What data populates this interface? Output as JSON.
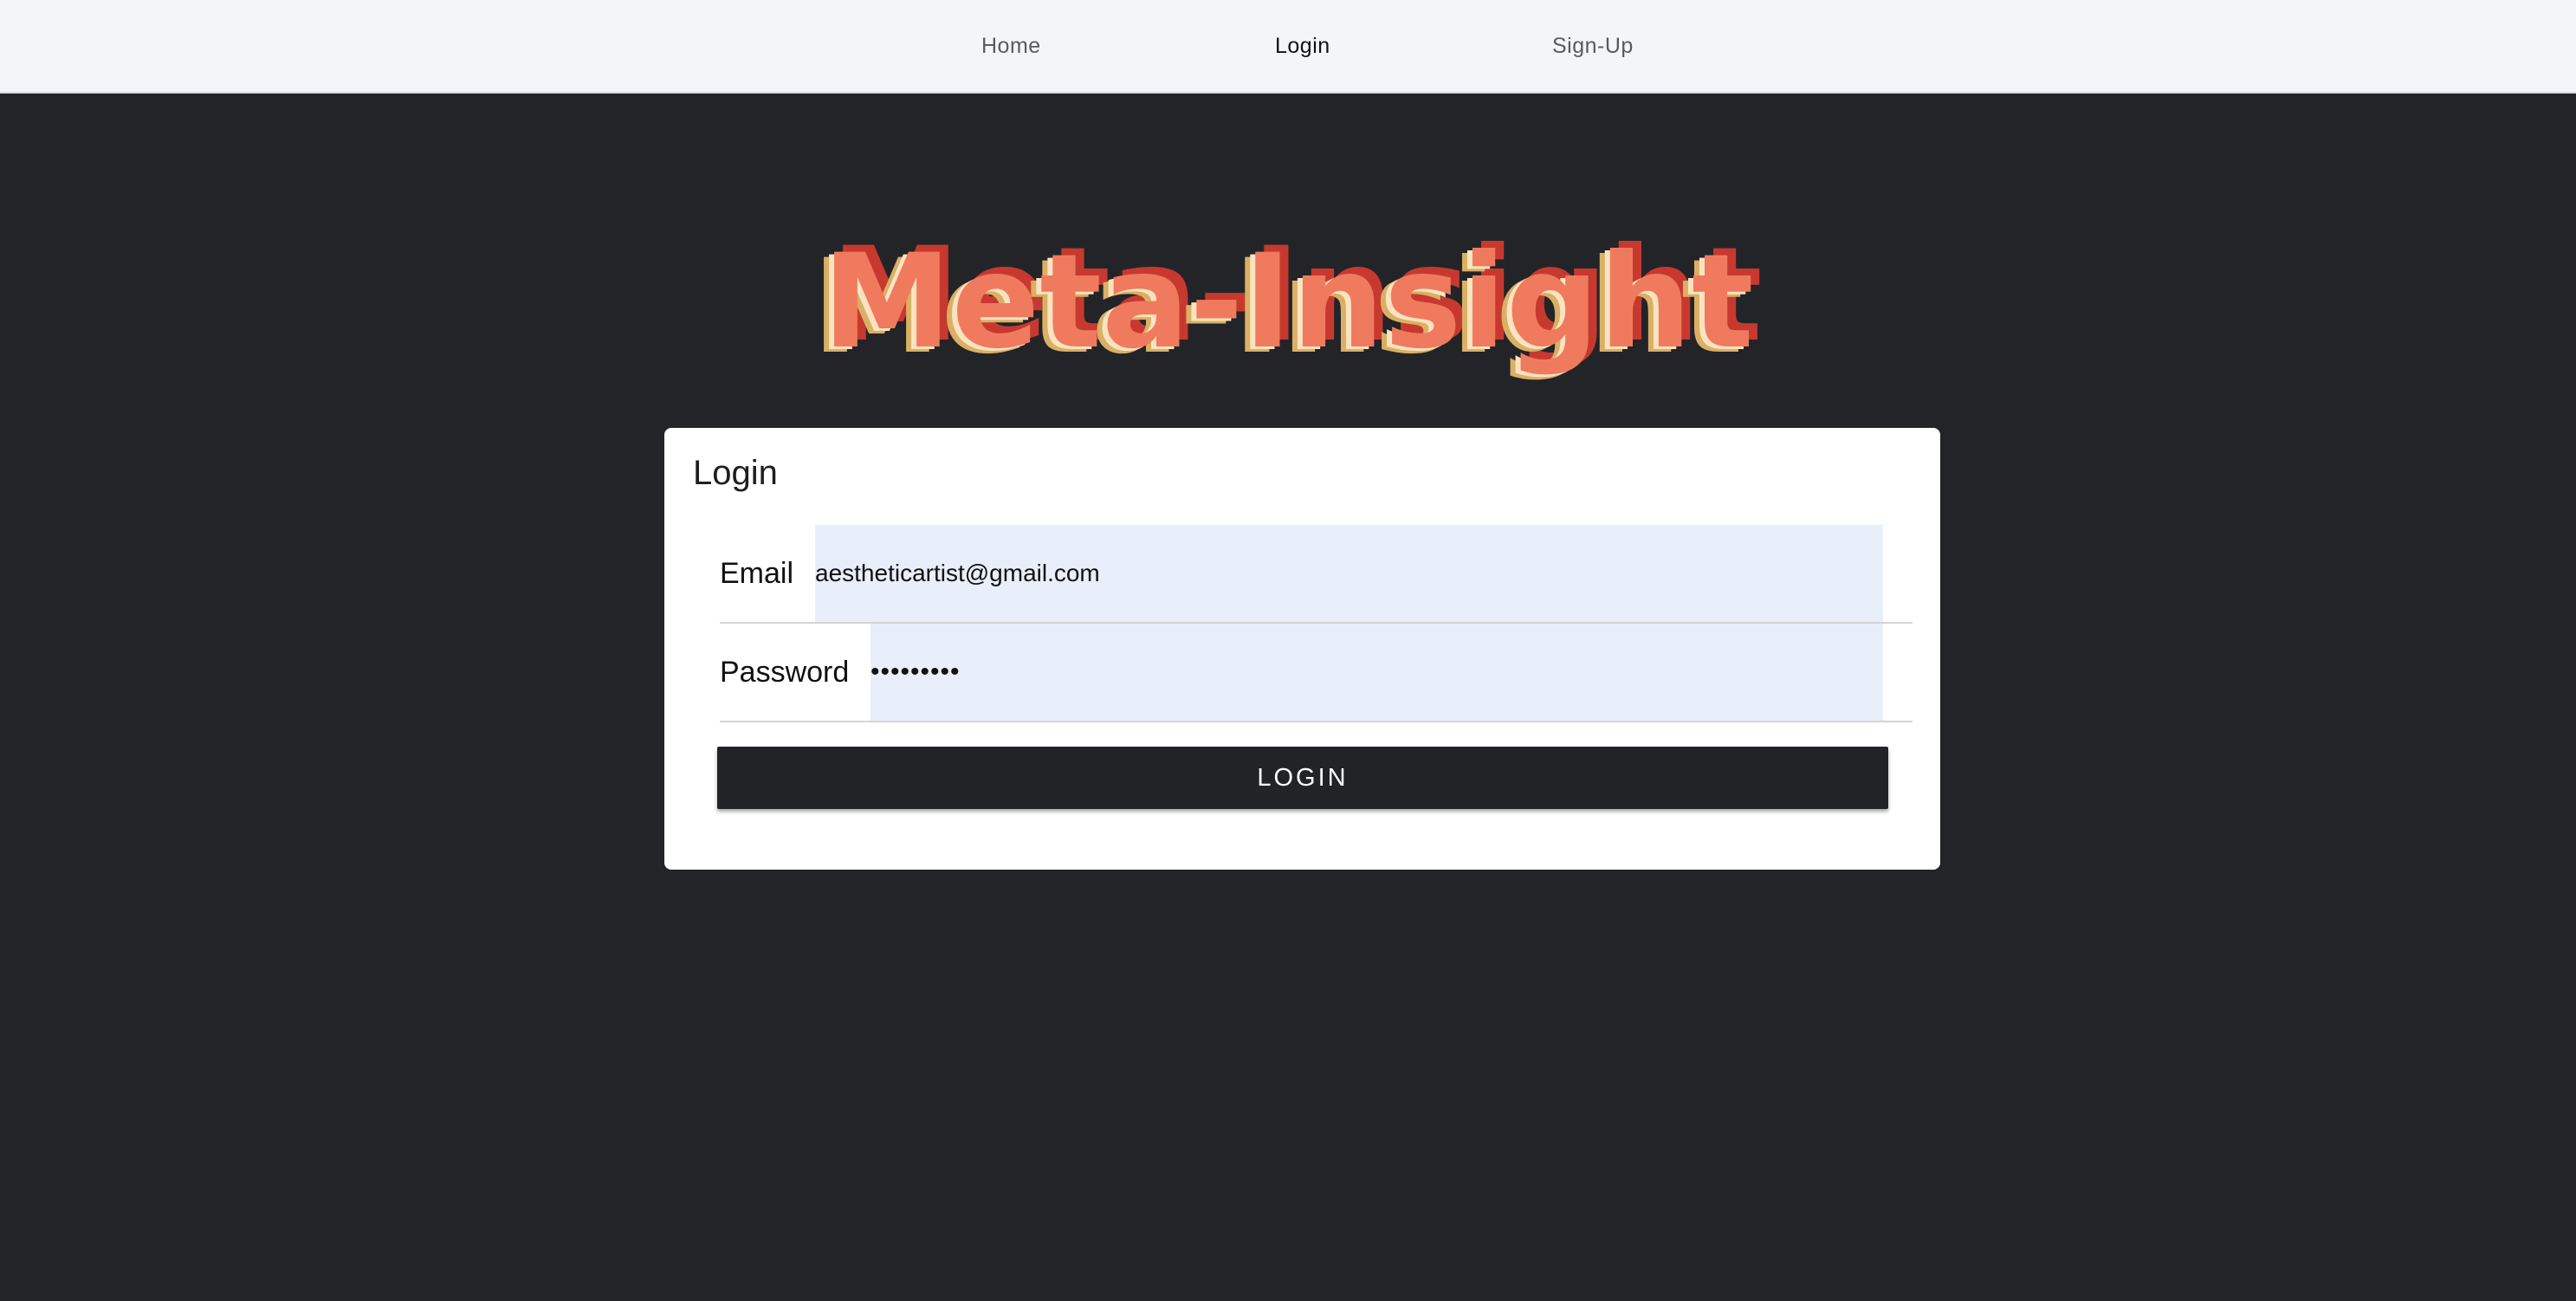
{
  "nav": {
    "items": [
      {
        "label": "Home"
      },
      {
        "label": "Login"
      },
      {
        "label": "Sign-Up"
      }
    ],
    "active": "Login"
  },
  "brand": {
    "title": "Meta-Insight",
    "colors": {
      "front": "#f07a5e",
      "stripe_light": "#fbe3c0",
      "stripe_gold": "#d9b064",
      "stripe_red": "#c7392f"
    }
  },
  "login_card": {
    "title": "Login",
    "email": {
      "label": "Email",
      "value": "aestheticartist@gmail.com"
    },
    "password": {
      "label": "Password",
      "value": "•••••••••"
    },
    "submit_label": "LOGIN"
  },
  "colors": {
    "page_background": "#232428",
    "navbar_background": "#f3f5f9",
    "card_background": "#ffffff",
    "input_background": "#e8effb",
    "button_background": "#222327"
  }
}
